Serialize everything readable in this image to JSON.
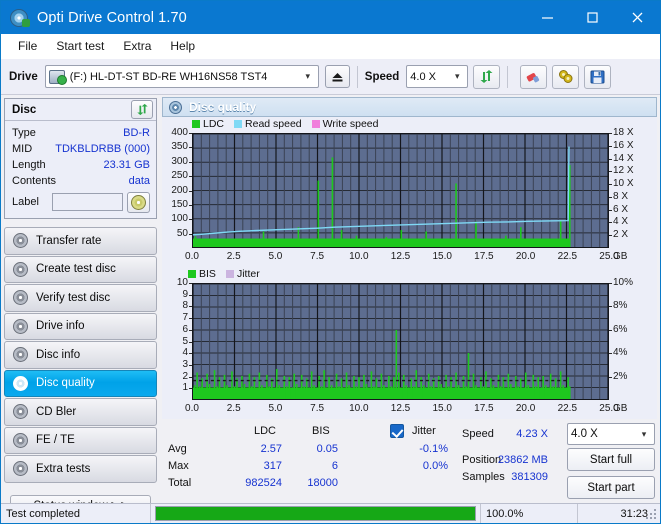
{
  "window": {
    "title": "Opti Drive Control 1.70",
    "icon": "disc-icon",
    "minimize": "−",
    "maximize": "□",
    "close": "×"
  },
  "menu": [
    {
      "label": "File"
    },
    {
      "label": "Start test"
    },
    {
      "label": "Extra"
    },
    {
      "label": "Help"
    }
  ],
  "toolbar": {
    "drive_label": "Drive",
    "drive_value": "(F:)  HL-DT-ST BD-RE  WH16NS58 TST4",
    "eject_icon": "eject-icon",
    "speed_label": "Speed",
    "speed_value": "4.0 X",
    "refresh_icon": "refresh-icon",
    "erase_icon": "eraser-icon",
    "settings_icon": "gears-icon",
    "save_icon": "save-icon"
  },
  "disc_panel": {
    "header": "Disc",
    "refresh_icon": "refresh-icon",
    "rows": [
      {
        "key": "Type",
        "value": "BD-R"
      },
      {
        "key": "MID",
        "value": "TDKBLDRBB (000)"
      },
      {
        "key": "Length",
        "value": "23.31 GB"
      },
      {
        "key": "Contents",
        "value": "data"
      }
    ],
    "label_key": "Label",
    "label_value": "",
    "label_placeholder": "",
    "disc_button_icon": "cd-icon"
  },
  "sidebar": {
    "items": [
      {
        "label": "Transfer rate",
        "active": false
      },
      {
        "label": "Create test disc",
        "active": false
      },
      {
        "label": "Verify test disc",
        "active": false
      },
      {
        "label": "Drive info",
        "active": false
      },
      {
        "label": "Disc info",
        "active": false
      },
      {
        "label": "Disc quality",
        "active": true
      },
      {
        "label": "CD Bler",
        "active": false
      },
      {
        "label": "FE / TE",
        "active": false
      },
      {
        "label": "Extra tests",
        "active": false
      }
    ],
    "status_window": "Status window > >"
  },
  "content": {
    "header_icon": "disc-quality-icon",
    "header_title": "Disc quality"
  },
  "stats": {
    "col_ldc": "LDC",
    "col_bis": "BIS",
    "jitter_label": "Jitter",
    "jitter_checked": true,
    "rows": [
      {
        "name": "Avg",
        "ldc": "2.57",
        "bis": "0.05",
        "jitter": "-0.1%"
      },
      {
        "name": "Max",
        "ldc": "317",
        "bis": "6",
        "jitter": "0.0%"
      },
      {
        "name": "Total",
        "ldc": "982524",
        "bis": "18000",
        "jitter": ""
      }
    ],
    "speed_label": "Speed",
    "speed_value": "4.23 X",
    "speed_select": "4.0 X",
    "position_label": "Position",
    "position_value": "23862 MB",
    "samples_label": "Samples",
    "samples_value": "381309",
    "start_full": "Start full",
    "start_part": "Start part"
  },
  "statusbar": {
    "message": "Test completed",
    "percent_text": "100.0%",
    "percent_value": 100,
    "elapsed": "31:23"
  },
  "colors": {
    "accent": "#0a78d0",
    "ldc_green": "#1ec81e",
    "bis_green": "#1ec81e",
    "read_speed": "#7fd9f5",
    "write_speed": "#f07fdc",
    "jitter": "#cbb4e0",
    "plot_bg": "#5d6d90",
    "grid": "#2a2f3a",
    "value_text": "#1633d0",
    "progress": "#16a816"
  },
  "chart_data": [
    {
      "type": "line",
      "name": "disc-quality-ldc-chart",
      "title": "",
      "xlabel": "GB",
      "ylabel": "LDC",
      "y2label": "X",
      "xlim": [
        0.0,
        25.0
      ],
      "ylim": [
        0,
        400
      ],
      "y2lim": [
        0,
        18
      ],
      "xticks": [
        "0.0",
        "2.5",
        "5.0",
        "7.5",
        "10.0",
        "12.5",
        "15.0",
        "17.5",
        "20.0",
        "22.5",
        "25.0"
      ],
      "yticks": [
        400,
        350,
        300,
        250,
        200,
        150,
        100,
        50
      ],
      "y2ticks": [
        "18 X",
        "16 X",
        "14 X",
        "12 X",
        "10 X",
        "8 X",
        "6 X",
        "4 X",
        "2 X"
      ],
      "x_unit": "GB",
      "grid": true,
      "legend": [
        {
          "name": "LDC",
          "color": "#1ec81e"
        },
        {
          "name": "Read speed",
          "color": "#7fd9f5"
        },
        {
          "name": "Write speed",
          "color": "#f07fdc"
        }
      ],
      "series": [
        {
          "name": "LDC",
          "type": "impulse",
          "color": "#1ec81e",
          "x": [
            0.1,
            0.35,
            0.6,
            0.9,
            1.2,
            1.5,
            1.8,
            2.1,
            2.4,
            2.7,
            3.0,
            3.3,
            3.6,
            3.9,
            4.2,
            4.5,
            4.8,
            5.1,
            5.4,
            5.7,
            6.0,
            6.3,
            6.6,
            6.9,
            7.2,
            7.5,
            7.8,
            8.05,
            8.35,
            8.6,
            8.9,
            9.2,
            9.5,
            9.8,
            10.1,
            10.4,
            10.7,
            11.0,
            11.3,
            11.6,
            11.9,
            12.2,
            12.5,
            12.8,
            13.1,
            13.4,
            13.7,
            14.0,
            14.3,
            14.6,
            14.9,
            15.2,
            15.5,
            15.8,
            16.1,
            16.4,
            16.7,
            17.0,
            17.3,
            17.6,
            17.9,
            18.2,
            18.5,
            18.8,
            19.1,
            19.4,
            19.7,
            20.0,
            20.3,
            20.6,
            20.9,
            21.2,
            21.5,
            21.8,
            22.1,
            22.4,
            22.65
          ],
          "y": [
            38,
            20,
            22,
            18,
            26,
            20,
            24,
            18,
            30,
            22,
            20,
            26,
            18,
            24,
            55,
            20,
            30,
            18,
            22,
            26,
            20,
            70,
            24,
            18,
            30,
            235,
            20,
            26,
            317,
            22,
            60,
            24,
            18,
            40,
            22,
            30,
            18,
            26,
            20,
            35,
            24,
            18,
            60,
            22,
            30,
            18,
            26,
            55,
            20,
            24,
            18,
            30,
            22,
            225,
            26,
            20,
            18,
            90,
            24,
            30,
            22,
            18,
            26,
            40,
            20,
            24,
            70,
            18,
            30,
            22,
            26,
            20,
            18,
            24,
            95,
            22,
            290
          ]
        },
        {
          "name": "Read speed",
          "type": "line",
          "color": "#7fd9f5",
          "x": [
            0.0,
            0.6,
            1.3,
            2.0,
            2.8,
            3.6,
            4.5,
            5.5,
            6.5,
            7.5,
            8.5,
            9.6,
            10.7,
            11.8,
            13.0,
            14.2,
            15.4,
            16.6,
            17.8,
            19.0,
            20.2,
            21.4,
            22.6,
            22.65
          ],
          "y": [
            1.95,
            2.05,
            2.2,
            2.35,
            2.5,
            2.6,
            2.7,
            2.8,
            2.9,
            3.0,
            3.15,
            3.25,
            3.35,
            3.45,
            3.55,
            3.65,
            3.75,
            3.85,
            3.95,
            4.0,
            4.1,
            4.15,
            4.2,
            16.0
          ]
        }
      ]
    },
    {
      "type": "line",
      "name": "disc-quality-bis-chart",
      "title": "",
      "xlabel": "GB",
      "ylabel": "BIS",
      "y2label": "%",
      "xlim": [
        0.0,
        25.0
      ],
      "ylim": [
        0,
        10
      ],
      "y2lim": [
        0,
        10
      ],
      "xticks": [
        "0.0",
        "2.5",
        "5.0",
        "7.5",
        "10.0",
        "12.5",
        "15.0",
        "17.5",
        "20.0",
        "22.5",
        "25.0"
      ],
      "yticks": [
        10,
        9,
        8,
        7,
        6,
        5,
        4,
        3,
        2,
        1
      ],
      "y2ticks": [
        "10%",
        "8%",
        "6%",
        "4%",
        "2%"
      ],
      "x_unit": "GB",
      "grid": true,
      "legend": [
        {
          "name": "BIS",
          "color": "#1ec81e"
        },
        {
          "name": "Jitter",
          "color": "#cbb4e0"
        }
      ],
      "series": [
        {
          "name": "BIS",
          "type": "impulse",
          "color": "#1ec81e",
          "x": [
            0.05,
            0.2,
            0.35,
            0.5,
            0.65,
            0.8,
            0.95,
            1.1,
            1.25,
            1.4,
            1.55,
            1.7,
            1.85,
            2.0,
            2.15,
            2.3,
            2.45,
            2.6,
            2.75,
            2.9,
            3.05,
            3.2,
            3.35,
            3.5,
            3.65,
            3.8,
            3.95,
            4.1,
            4.25,
            4.4,
            4.55,
            4.7,
            4.85,
            5.0,
            5.15,
            5.3,
            5.45,
            5.6,
            5.75,
            5.9,
            6.05,
            6.2,
            6.35,
            6.5,
            6.65,
            6.8,
            6.95,
            7.1,
            7.25,
            7.4,
            7.55,
            7.7,
            7.85,
            8.0,
            8.15,
            8.3,
            8.45,
            8.6,
            8.75,
            8.9,
            9.05,
            9.2,
            9.35,
            9.5,
            9.65,
            9.8,
            9.95,
            10.1,
            10.25,
            10.4,
            10.55,
            10.7,
            10.85,
            11.0,
            11.15,
            11.3,
            11.45,
            11.6,
            11.75,
            11.9,
            12.05,
            12.2,
            12.35,
            12.5,
            12.65,
            12.8,
            12.95,
            13.1,
            13.25,
            13.4,
            13.55,
            13.7,
            13.85,
            14.0,
            14.15,
            14.3,
            14.45,
            14.6,
            14.75,
            14.9,
            15.05,
            15.2,
            15.35,
            15.5,
            15.65,
            15.8,
            15.95,
            16.1,
            16.25,
            16.4,
            16.55,
            16.7,
            16.85,
            17.0,
            17.15,
            17.3,
            17.45,
            17.6,
            17.75,
            17.9,
            18.05,
            18.2,
            18.35,
            18.5,
            18.65,
            18.8,
            18.95,
            19.1,
            19.25,
            19.4,
            19.55,
            19.7,
            19.85,
            20.0,
            20.15,
            20.3,
            20.45,
            20.6,
            20.75,
            20.9,
            21.05,
            21.2,
            21.35,
            21.5,
            21.65,
            21.8,
            21.95,
            22.1,
            22.25,
            22.4,
            22.55,
            22.65
          ],
          "y": [
            1.2,
            2.3,
            1.1,
            1.8,
            1.0,
            2.2,
            1.3,
            1.0,
            2.5,
            1.1,
            1.9,
            1.0,
            2.1,
            1.2,
            1.0,
            2.4,
            1.1,
            1.8,
            1.0,
            2.0,
            1.3,
            1.0,
            2.2,
            1.1,
            1.9,
            1.0,
            2.3,
            1.2,
            1.0,
            2.1,
            1.1,
            1.8,
            1.0,
            2.6,
            1.2,
            1.0,
            2.0,
            1.1,
            1.9,
            1.0,
            2.2,
            1.3,
            1.0,
            2.1,
            1.1,
            1.8,
            1.0,
            2.4,
            1.2,
            1.0,
            2.0,
            1.1,
            2.5,
            1.0,
            1.9,
            1.2,
            1.0,
            2.2,
            1.1,
            1.8,
            1.0,
            2.3,
            1.2,
            1.0,
            2.0,
            1.1,
            1.9,
            1.0,
            2.1,
            1.3,
            1.0,
            2.4,
            1.1,
            1.8,
            1.0,
            2.2,
            1.2,
            1.0,
            2.0,
            1.1,
            1.9,
            6.0,
            2.3,
            1.0,
            2.1,
            1.2,
            1.0,
            1.8,
            1.1,
            2.5,
            1.0,
            1.9,
            1.2,
            1.0,
            2.2,
            1.1,
            1.8,
            1.0,
            2.0,
            1.3,
            1.0,
            2.1,
            1.1,
            1.9,
            1.0,
            2.3,
            1.2,
            1.0,
            2.0,
            1.1,
            4.0,
            1.0,
            2.2,
            1.2,
            1.0,
            1.9,
            1.1,
            2.4,
            1.0,
            1.8,
            1.2,
            1.0,
            2.1,
            1.1,
            1.9,
            1.0,
            2.2,
            1.3,
            1.0,
            2.0,
            1.1,
            1.8,
            1.0,
            2.3,
            1.2,
            1.0,
            2.1,
            1.1,
            1.9,
            1.0,
            2.0,
            1.2,
            1.0,
            2.2,
            1.1,
            1.8,
            1.0,
            2.4,
            1.2,
            1.0,
            1.9,
            1.1,
            2.0
          ]
        }
      ]
    }
  ]
}
